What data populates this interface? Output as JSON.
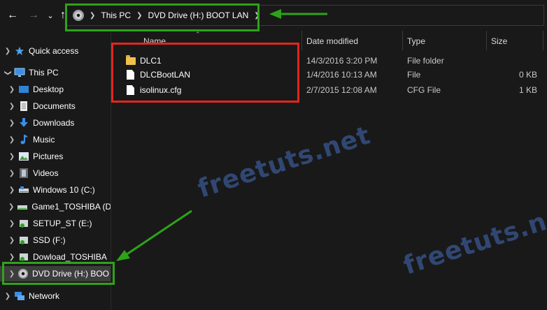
{
  "breadcrumb": [
    "This PC",
    "DVD Drive (H:) BOOT LAN"
  ],
  "columns": {
    "name": "Name",
    "date": "Date modified",
    "type": "Type",
    "size": "Size"
  },
  "files": [
    {
      "name": "DLC1",
      "icon": "folder-icon",
      "date": "14/3/2016 3:20 PM",
      "type": "File folder",
      "size": ""
    },
    {
      "name": "DLCBootLAN",
      "icon": "file-icon",
      "date": "1/4/2016 10:13 AM",
      "type": "File",
      "size": "0 KB"
    },
    {
      "name": "isolinux.cfg",
      "icon": "file-icon",
      "date": "2/7/2015 12:08 AM",
      "type": "CFG File",
      "size": "1 KB"
    }
  ],
  "sidebar": {
    "quick_access": "Quick access",
    "this_pc": "This PC",
    "desktop": "Desktop",
    "documents": "Documents",
    "downloads": "Downloads",
    "music": "Music",
    "pictures": "Pictures",
    "videos": "Videos",
    "win10": "Windows 10 (C:)",
    "game1": "Game1_TOSHIBA (D",
    "setup": "SETUP_ST (E:)",
    "ssd": "SSD (F:)",
    "dowload": "Dowload_TOSHIBA",
    "dvd": "DVD Drive (H:) BOO",
    "network": "Network"
  },
  "watermark": "freetuts.net",
  "colors": {
    "annotation_green": "#2ea319",
    "annotation_red": "#e3261e",
    "folder": "#f0c04a",
    "selection": "#3d3d3d"
  }
}
